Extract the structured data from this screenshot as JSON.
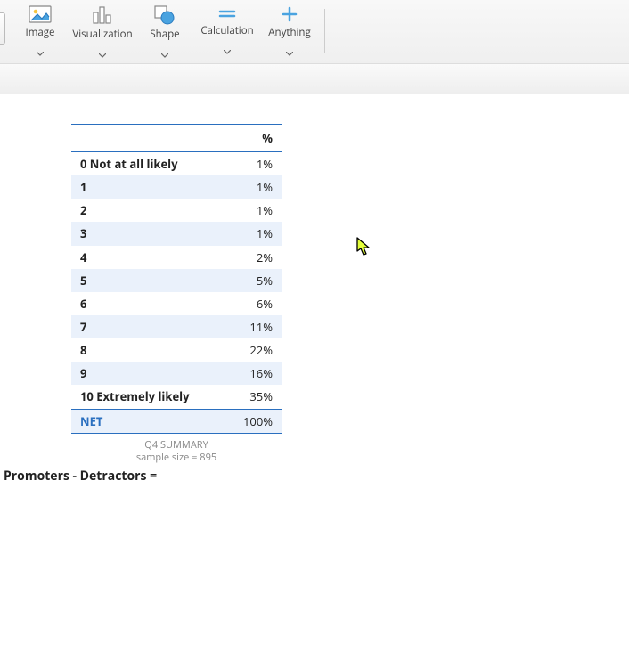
{
  "toolbar": {
    "items": [
      {
        "label": "Image"
      },
      {
        "label": "Visualization"
      },
      {
        "label": "Shape"
      },
      {
        "label": "Calculation"
      },
      {
        "label": "Anything"
      }
    ]
  },
  "table": {
    "header_label": "",
    "header_value": "%",
    "rows": [
      {
        "label": "0 Not at all likely",
        "value": "1%",
        "band": false
      },
      {
        "label": "1",
        "value": "1%",
        "band": true
      },
      {
        "label": "2",
        "value": "1%",
        "band": false
      },
      {
        "label": "3",
        "value": "1%",
        "band": true
      },
      {
        "label": "4",
        "value": "2%",
        "band": false
      },
      {
        "label": "5",
        "value": "5%",
        "band": true
      },
      {
        "label": "6",
        "value": "6%",
        "band": false
      },
      {
        "label": "7",
        "value": "11%",
        "band": true
      },
      {
        "label": "8",
        "value": "22%",
        "band": false
      },
      {
        "label": "9",
        "value": "16%",
        "band": true
      },
      {
        "label": "10 Extremely likely",
        "value": "35%",
        "band": false
      }
    ],
    "net_label": "NET",
    "net_value": "100%",
    "caption_line1": "Q4 SUMMARY",
    "caption_line2": "sample size = 895"
  },
  "formula": "Promoters - Detractors =",
  "chart_data": {
    "type": "table",
    "title": "Q4 SUMMARY",
    "sample_size": 895,
    "categories": [
      "0 Not at all likely",
      "1",
      "2",
      "3",
      "4",
      "5",
      "6",
      "7",
      "8",
      "9",
      "10 Extremely likely",
      "NET"
    ],
    "values_percent": [
      1,
      1,
      1,
      1,
      2,
      5,
      6,
      11,
      22,
      16,
      35,
      100
    ]
  }
}
